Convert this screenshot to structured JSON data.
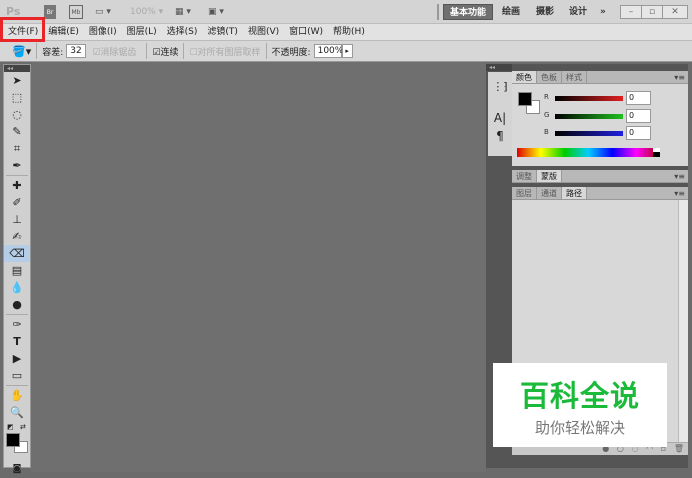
{
  "titlebar": {
    "logo": "Ps",
    "br_label": "Br",
    "mb_label": "Mb",
    "zoom": "100%",
    "workspaces": [
      "基本功能",
      "绘画",
      "摄影",
      "设计"
    ],
    "more": "»",
    "window_buttons": [
      "minimize",
      "restore",
      "close"
    ]
  },
  "menu": [
    "文件(F)",
    "编辑(E)",
    "图像(I)",
    "图层(L)",
    "选择(S)",
    "滤镜(T)",
    "视图(V)",
    "窗口(W)",
    "帮助(H)"
  ],
  "options": {
    "tolerance_label": "容差:",
    "tolerance_value": "32",
    "antialias_label": "消除锯齿",
    "contiguous_label": "连续",
    "sample_all_label": "对所有图层取样",
    "opacity_label": "不透明度:",
    "opacity_value": "100%"
  },
  "tools": [
    "move",
    "marquee",
    "lasso",
    "quick-select",
    "crop",
    "eyedropper",
    "healing",
    "brush",
    "stamp",
    "history-brush",
    "eraser",
    "gradient",
    "blur",
    "dodge",
    "pen",
    "type",
    "path-select",
    "shape",
    "hand",
    "zoom"
  ],
  "color_panel": {
    "tabs": [
      "颜色",
      "色板",
      "样式"
    ],
    "channels": [
      {
        "label": "R",
        "value": "0",
        "color": "#e02020"
      },
      {
        "label": "G",
        "value": "0",
        "color": "#20c020"
      },
      {
        "label": "B",
        "value": "0",
        "color": "#2020e0"
      }
    ],
    "foreground": "#000000",
    "background": "#ffffff"
  },
  "adjust_panel": {
    "tabs": [
      "调整",
      "蒙版"
    ]
  },
  "layers_panel": {
    "tabs": [
      "图层",
      "通道",
      "路径"
    ],
    "active": "路径"
  },
  "watermark": {
    "title": "百科全说",
    "subtitle": "助你轻松解决"
  }
}
